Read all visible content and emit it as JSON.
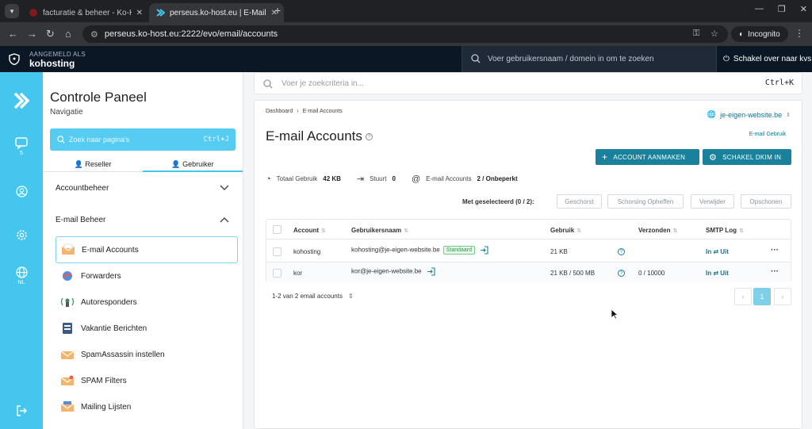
{
  "browser": {
    "tabs": [
      {
        "title": "facturatie & beheer - Ko-Host.be",
        "active": false
      },
      {
        "title": "perseus.ko-host.eu | E-Mail Acc",
        "active": true
      }
    ],
    "url": "perseus.ko-host.eu:2222/evo/email/accounts",
    "incognito_label": "Incognito"
  },
  "topbar": {
    "logged_in_label": "AANGEMELD ALS",
    "username": "kohosting",
    "search_placeholder": "Voer gebruikersnaam / domein in om te zoeken",
    "switch_user": "Schakel over naar kvs"
  },
  "iconbar": {
    "messages_count": "5",
    "language": "NL"
  },
  "nav": {
    "title": "Controle Paneel",
    "subtitle": "Navigatie",
    "search_placeholder": "Zoek naar pagina's",
    "search_shortcut": "Ctrl+J",
    "tab_reseller": "Reseller",
    "tab_user": "Gebruiker",
    "section_account": "Accountbeheer",
    "section_email": "E-mail Beheer",
    "items": [
      {
        "label": "E-mail Accounts",
        "icon": "envelope-icon"
      },
      {
        "label": "Forwarders",
        "icon": "forward-icon"
      },
      {
        "label": "Autoresponders",
        "icon": "autoresponder-icon"
      },
      {
        "label": "Vakantie Berichten",
        "icon": "vacation-icon"
      },
      {
        "label": "SpamAssassin instellen",
        "icon": "spamassassin-icon"
      },
      {
        "label": "SPAM Filters",
        "icon": "spam-filter-icon"
      },
      {
        "label": "Mailing Lijsten",
        "icon": "mailing-list-icon"
      }
    ]
  },
  "main": {
    "search_placeholder": "Voer je zoekcriteria in...",
    "search_shortcut": "Ctrl+K",
    "breadcrumb": [
      "Dashboard",
      "E-mail Accounts"
    ],
    "domain": "je-eigen-website.be",
    "title": "E-mail Accounts",
    "email_usage_link": "E-mail Gebruik",
    "btn_create": "ACCOUNT AANMAKEN",
    "btn_dkim": "SCHAKEL DKIM IN",
    "stats": {
      "total_label": "Totaal Gebruik",
      "total_value": "42 KB",
      "sent_label": "Stuurt",
      "sent_value": "0",
      "accounts_label": "E-mail Accounts",
      "accounts_value": "2 / Onbeperkt"
    },
    "selected_label": "Met geselecteerd (0 / 2):",
    "actions": [
      "Geschorst",
      "Schorsing Opheffen",
      "Verwijder",
      "Opschonen"
    ],
    "table": {
      "headers": [
        "Account",
        "Gebruikersnaam",
        "Gebruik",
        "Verzonden",
        "SMTP Log"
      ],
      "rows": [
        {
          "account": "kohosting",
          "username": "kohosting@je-eigen-website.be",
          "badge": "Standaard",
          "usage": "21 KB",
          "sent": "",
          "smtp_in": "In",
          "smtp_out": "Uit"
        },
        {
          "account": "kor",
          "username": "kor@je-eigen-website.be",
          "badge": "",
          "usage": "21 KB / 500 MB",
          "sent": "0 / 10000",
          "smtp_in": "In",
          "smtp_out": "Uit"
        }
      ]
    },
    "pager_info": "1-2 van 2 email accounts",
    "current_page": "1"
  },
  "colors": {
    "accent": "#44c6ef",
    "primary_button": "#19819b",
    "topbar": "#0b1724"
  }
}
